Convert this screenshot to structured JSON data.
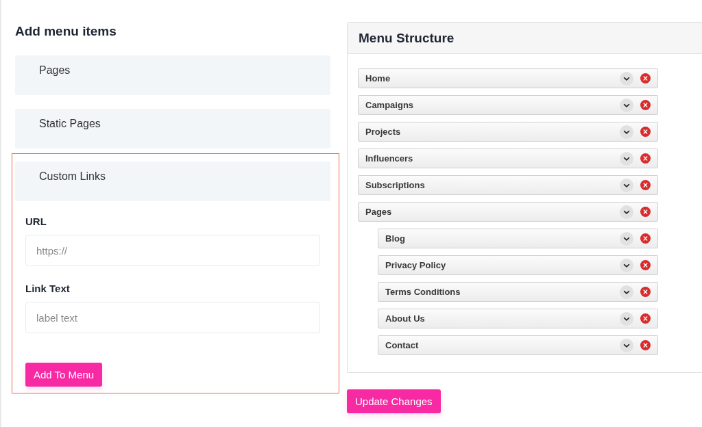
{
  "add_panel": {
    "title": "Add menu items",
    "sections": [
      {
        "label": "Pages",
        "expanded": false
      },
      {
        "label": "Static Pages",
        "expanded": false
      },
      {
        "label": "Custom Links",
        "expanded": true,
        "fields": [
          {
            "label": "URL",
            "placeholder": "https://"
          },
          {
            "label": "Link Text",
            "placeholder": "label text"
          }
        ],
        "button": "Add To Menu"
      }
    ]
  },
  "menu_structure": {
    "title": "Menu Structure",
    "items": [
      {
        "label": "Home"
      },
      {
        "label": "Campaigns"
      },
      {
        "label": "Projects"
      },
      {
        "label": "Influencers"
      },
      {
        "label": "Subscriptions"
      },
      {
        "label": "Pages",
        "children": [
          {
            "label": "Blog"
          },
          {
            "label": "Privacy Policy"
          },
          {
            "label": "Terms Conditions"
          },
          {
            "label": "About Us"
          },
          {
            "label": "Contact"
          }
        ]
      }
    ]
  },
  "update_button": "Update Changes"
}
